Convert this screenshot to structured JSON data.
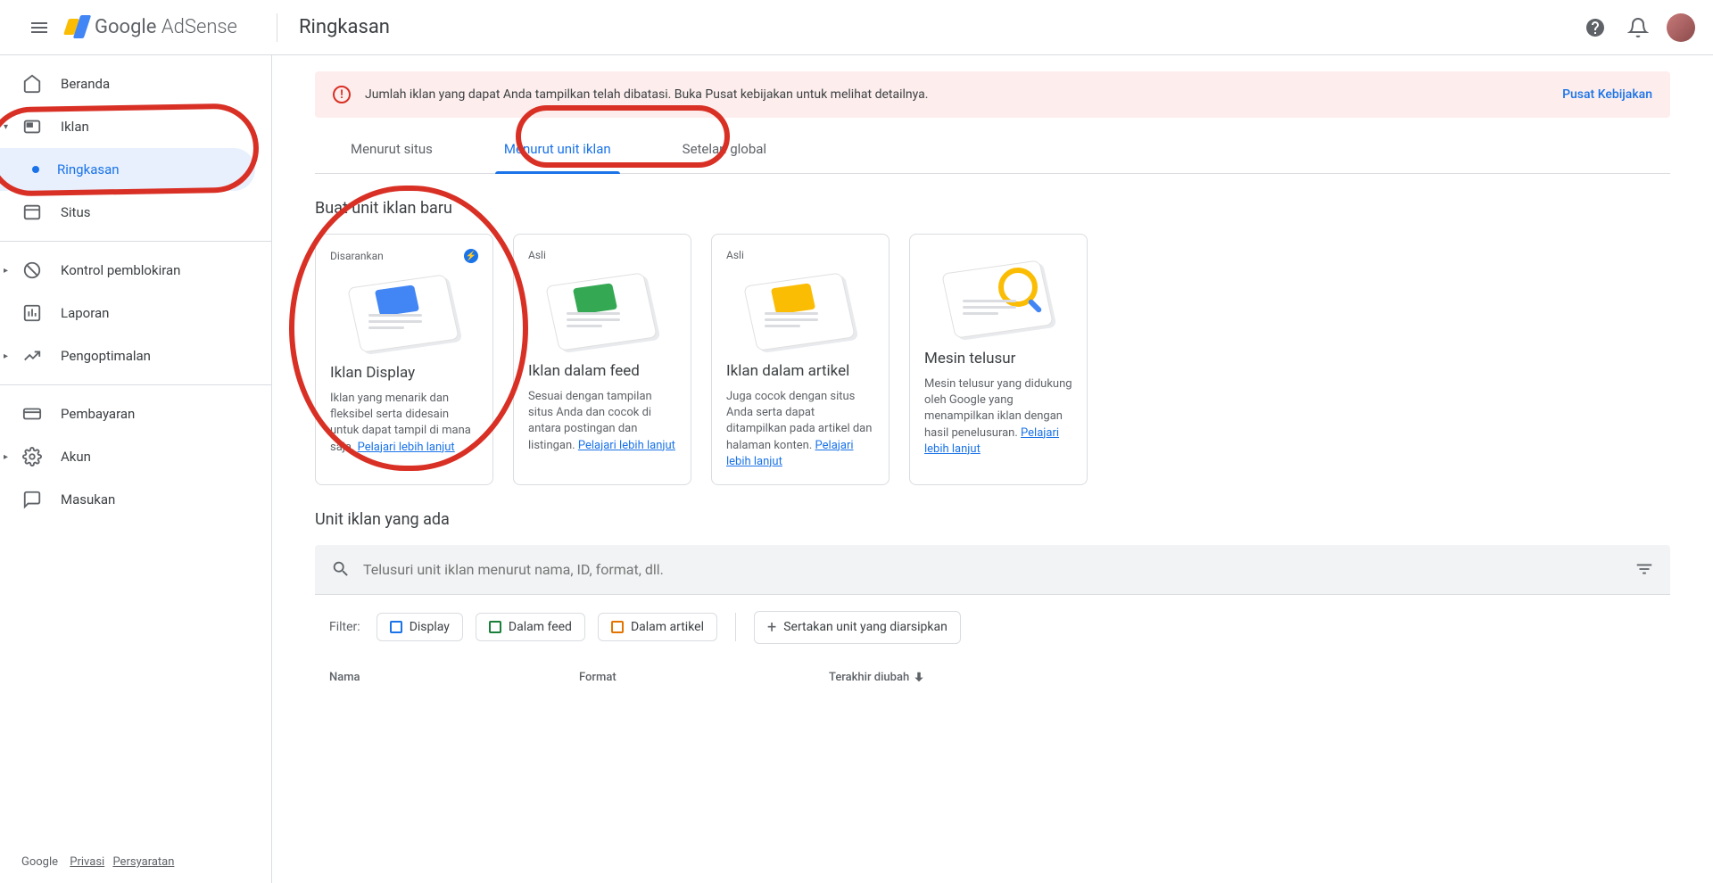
{
  "header": {
    "product": "Google",
    "product_sub": "AdSense",
    "page_title": "Ringkasan"
  },
  "sidebar": {
    "items": {
      "beranda": "Beranda",
      "iklan": "Iklan",
      "ringkasan": "Ringkasan",
      "situs": "Situs",
      "kontrol": "Kontrol pemblokiran",
      "laporan": "Laporan",
      "pengoptimalan": "Pengoptimalan",
      "pembayaran": "Pembayaran",
      "akun": "Akun",
      "masukan": "Masukan"
    },
    "footer": {
      "google": "Google",
      "privasi": "Privasi",
      "persyaratan": "Persyaratan"
    }
  },
  "alert": {
    "text": "Jumlah iklan yang dapat Anda tampilkan telah dibatasi. Buka Pusat kebijakan untuk melihat detailnya.",
    "link": "Pusat Kebijakan"
  },
  "tabs": {
    "situs": "Menurut situs",
    "unit": "Menurut unit iklan",
    "global": "Setelan global"
  },
  "new_unit": {
    "title": "Buat unit iklan baru",
    "cards": [
      {
        "badge": "Disarankan",
        "title": "Iklan Display",
        "desc": "Iklan yang menarik dan fleksibel serta didesain untuk dapat tampil di mana saja.",
        "link": "Pelajari lebih lanjut"
      },
      {
        "badge": "Asli",
        "title": "Iklan dalam feed",
        "desc": "Sesuai dengan tampilan situs Anda dan cocok di antara postingan dan listingan.",
        "link": "Pelajari lebih lanjut"
      },
      {
        "badge": "Asli",
        "title": "Iklan dalam artikel",
        "desc": "Juga cocok dengan situs Anda serta dapat ditampilkan pada artikel dan halaman konten.",
        "link": "Pelajari lebih lanjut"
      },
      {
        "badge": "",
        "title": "Mesin telusur",
        "desc": "Mesin telusur yang didukung oleh Google yang menampilkan iklan dengan hasil penelusuran.",
        "link": "Pelajari lebih lanjut"
      }
    ]
  },
  "existing": {
    "title": "Unit iklan yang ada",
    "search_placeholder": "Telusuri unit iklan menurut nama, ID, format, dll.",
    "filter_label": "Filter:",
    "chips": {
      "display": "Display",
      "feed": "Dalam feed",
      "artikel": "Dalam artikel",
      "arsip": "Sertakan unit yang diarsipkan"
    },
    "columns": {
      "nama": "Nama",
      "format": "Format",
      "diubah": "Terakhir diubah"
    }
  }
}
